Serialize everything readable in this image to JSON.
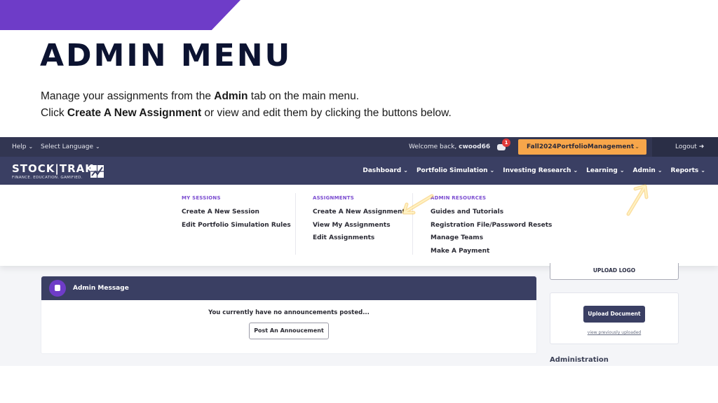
{
  "slide": {
    "title": "ADMIN MENU",
    "intro_line1": {
      "pre": "Manage your assignments from the ",
      "bold": "Admin",
      "post": " tab on the main menu."
    },
    "intro_line2": {
      "pre": "Click ",
      "bold": "Create A New Assignment",
      "post": " or view and edit them by clicking the buttons below."
    },
    "accent_color": "#6e3cc8",
    "arrow_color": "#f7b52c"
  },
  "topbar": {
    "help": "Help",
    "language": "Select Language",
    "welcome_prefix": "Welcome back, ",
    "username": "cwood66",
    "notification_count": "1",
    "session": "Fall2024PortfolioManagement",
    "logout": "Logout"
  },
  "logo": {
    "word": "STOCK|TRAK",
    "tagline": "FINANCE. EDUCATION. GAMIFIED."
  },
  "nav": [
    "Dashboard",
    "Portfolio Simulation",
    "Investing Research",
    "Learning",
    "Admin",
    "Reports"
  ],
  "mega_menu": {
    "columns": [
      {
        "heading": "MY SESSIONS",
        "links": [
          "Create A New Session",
          "Edit Portfolio Simulation Rules"
        ]
      },
      {
        "heading": "ASSIGNMENTS",
        "links": [
          "Create A New Assignment",
          "View My Assignments",
          "Edit Assignments"
        ]
      },
      {
        "heading": "ADMIN RESOURCES",
        "links": [
          "Guides and Tutorials",
          "Registration File/Password Resets",
          "Manage Teams",
          "Make A Payment"
        ]
      }
    ]
  },
  "admin_message": {
    "title": "Admin Message",
    "message": "You currently have no announcements posted...",
    "button": "Post An Annoucement"
  },
  "sidebar": {
    "upload_logo": "UPLOAD LOGO",
    "upload_document": "Upload Document",
    "view_previous": "view previously uploaded",
    "administration": "Administration"
  }
}
